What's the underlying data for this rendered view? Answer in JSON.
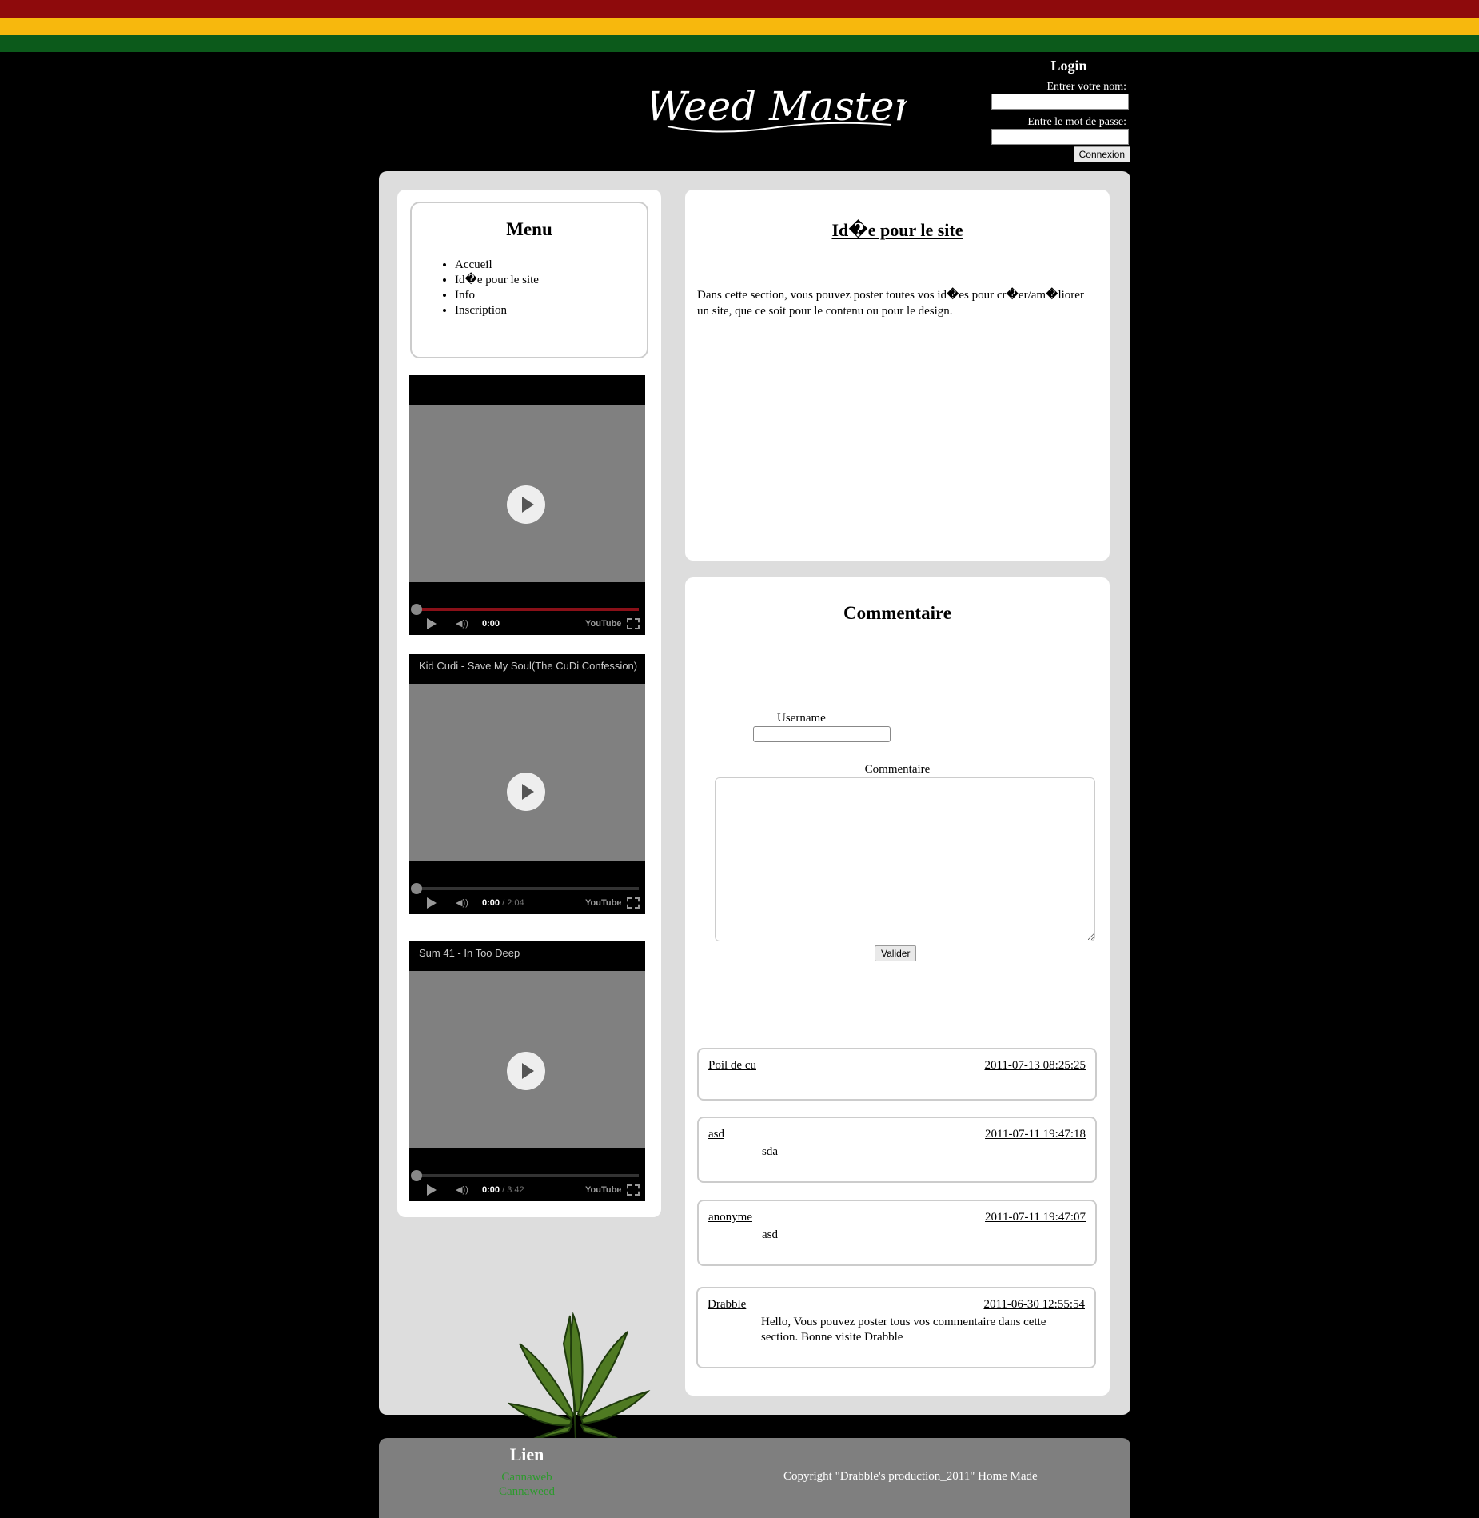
{
  "colors": {
    "stripe_red": "#8e0a0c",
    "stripe_yellow": "#f7b80d",
    "stripe_green": "#0c5a1b",
    "page_bg": "#000000",
    "link_green": "#2c9a2c"
  },
  "header": {
    "logo_text": "Weed Master"
  },
  "login": {
    "title": "Login",
    "name_label": "Entrer votre nom:",
    "password_label": "Entre le mot de passe:",
    "name_value": "",
    "password_value": "",
    "submit_label": "Connexion"
  },
  "menu": {
    "title": "Menu",
    "items": [
      {
        "label": "Accueil"
      },
      {
        "label": "Id�e pour le site"
      },
      {
        "label": "Info"
      },
      {
        "label": "Inscription"
      }
    ]
  },
  "videos": [
    {
      "title": "",
      "time": "0:00",
      "duration": ""
    },
    {
      "title": "Kid Cudi - Save My Soul(The CuDi Confession)",
      "time": "0:00",
      "duration": " / 2:04"
    },
    {
      "title": "Sum 41 - In Too Deep",
      "time": "0:00",
      "duration": " / 3:42"
    }
  ],
  "video_brand": "YouTube",
  "content": {
    "title": "Id�e pour le site",
    "text": "Dans cette section, vous pouvez poster toutes vos id�es pour cr�er/am�liorer un site, que ce soit pour le contenu ou pour le design."
  },
  "comment_form": {
    "title": "Commentaire",
    "username_label": "Username",
    "username_value": "",
    "comment_label": "Commentaire",
    "comment_value": "",
    "submit_label": "Valider"
  },
  "comments": [
    {
      "user": "Poil de cu",
      "date": "2011-07-13 08:25:25",
      "body": ""
    },
    {
      "user": "asd",
      "date": "2011-07-11 19:47:18",
      "body": "sda"
    },
    {
      "user": "anonyme",
      "date": "2011-07-11 19:47:07",
      "body": "asd"
    },
    {
      "user": "Drabble",
      "date": "2011-06-30 12:55:54",
      "body": "Hello, Vous pouvez poster tous vos commentaire dans cette section. Bonne visite Drabble"
    }
  ],
  "footer": {
    "links_title": "Lien",
    "links": [
      {
        "label": "Cannaweb"
      },
      {
        "label": "Cannaweed"
      }
    ],
    "copyright": "Copyright \"Drabble's production_2011\" Home Made"
  }
}
